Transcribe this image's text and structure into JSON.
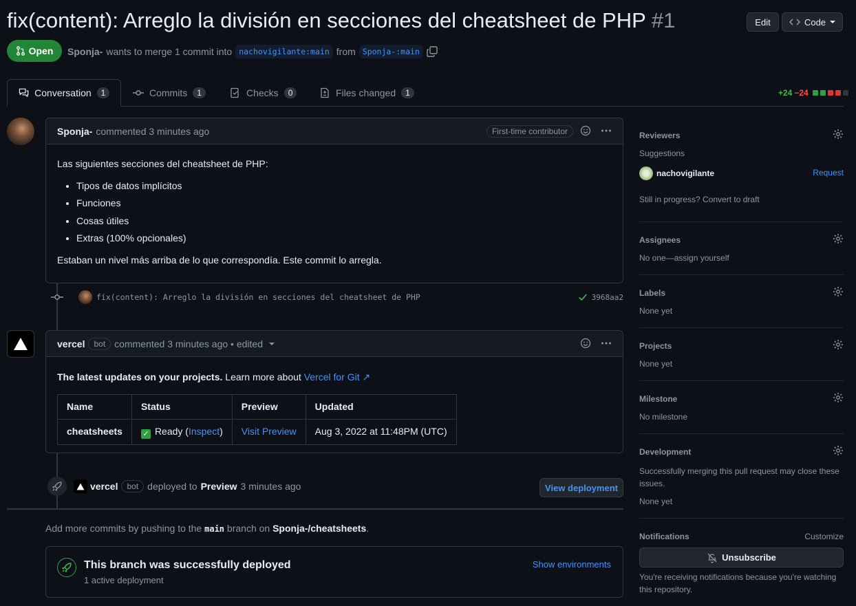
{
  "pr": {
    "title": "fix(content): Arreglo la división en secciones del cheatsheet de PHP",
    "number": "#1",
    "edit_label": "Edit",
    "code_label": "Code",
    "state": "Open",
    "author": "Sponja-",
    "merge_text": "wants to merge 1 commit into",
    "base_branch": "nachovigilante:main",
    "from_text": "from",
    "head_branch": "Sponja-:main"
  },
  "tabs": [
    {
      "label": "Conversation",
      "count": "1"
    },
    {
      "label": "Commits",
      "count": "1"
    },
    {
      "label": "Checks",
      "count": "0"
    },
    {
      "label": "Files changed",
      "count": "1"
    }
  ],
  "diffstat": {
    "additions": "+24",
    "deletions": "−24"
  },
  "comment1": {
    "author": "Sponja-",
    "action": "commented 3 minutes ago",
    "badge": "First-time contributor",
    "intro": "Las siguientes secciones del cheatsheet de PHP:",
    "items": [
      "Tipos de datos implícitos",
      "Funciones",
      "Cosas útiles",
      "Extras (100% opcionales)"
    ],
    "outro": "Estaban un nivel más arriba de lo que correspondía. Este commit lo arregla."
  },
  "commit": {
    "message": "fix(content): Arreglo la división en secciones del cheatsheet de PHP",
    "sha": "3968aa2"
  },
  "comment2": {
    "author": "vercel",
    "bot_label": "bot",
    "action": "commented 3 minutes ago • edited",
    "lead_bold": "The latest updates on your projects.",
    "lead_text": "Learn more about",
    "lead_link": "Vercel for Git ↗",
    "table": {
      "headers": [
        "Name",
        "Status",
        "Preview",
        "Updated"
      ],
      "row": {
        "name": "cheatsheets",
        "status": "Ready",
        "inspect": "Inspect",
        "preview": "Visit Preview",
        "updated": "Aug 3, 2022 at 11:48PM (UTC)"
      }
    }
  },
  "deploy_event": {
    "actor": "vercel",
    "bot_label": "bot",
    "action": "deployed to",
    "env": "Preview",
    "time": "3 minutes ago",
    "button": "View deployment"
  },
  "push_hint": {
    "prefix": "Add more commits by pushing to the",
    "branch": "main",
    "middle": "branch on",
    "repo": "Sponja-/cheatsheets",
    "suffix": "."
  },
  "deployed_box": {
    "title": "This branch was successfully deployed",
    "subtitle": "1 active deployment",
    "link": "Show environments"
  },
  "sidebar": {
    "reviewers": {
      "title": "Reviewers",
      "suggestions": "Suggestions",
      "user": "nachovigilante",
      "request": "Request",
      "draft_text": "Still in progress? Convert to draft"
    },
    "assignees": {
      "title": "Assignees",
      "text": "No one—assign yourself"
    },
    "labels": {
      "title": "Labels",
      "text": "None yet"
    },
    "projects": {
      "title": "Projects",
      "text": "None yet"
    },
    "milestone": {
      "title": "Milestone",
      "text": "No milestone"
    },
    "development": {
      "title": "Development",
      "text": "Successfully merging this pull request may close these issues.",
      "none": "None yet"
    },
    "notifications": {
      "title": "Notifications",
      "customize": "Customize",
      "unsubscribe": "Unsubscribe",
      "reason": "You're receiving notifications because you're watching this repository."
    }
  }
}
